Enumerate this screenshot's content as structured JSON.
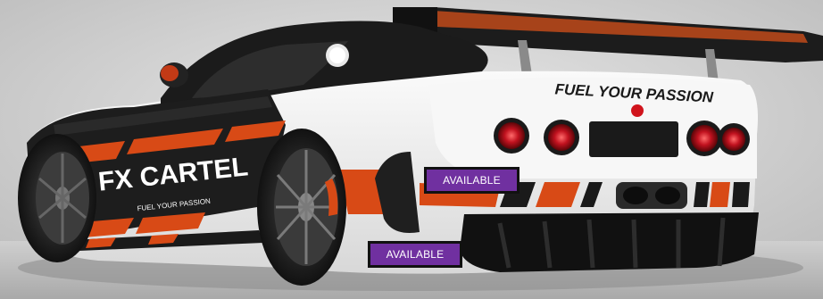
{
  "livery": {
    "slogan": "FUEL YOUR PASSION",
    "brand": "FX CARTEL",
    "brand_sub": "FUEL YOUR PASSION"
  },
  "badges": [
    {
      "label": "AVAILABLE"
    },
    {
      "label": "AVAILABLE"
    }
  ],
  "colors": {
    "background": "#d9d9d9",
    "body_white": "#f2f2f2",
    "body_black": "#1a1a1a",
    "accent_orange": "#d84a16",
    "tail_light_red": "#b3101a",
    "badge_purple": "#7030a0"
  }
}
